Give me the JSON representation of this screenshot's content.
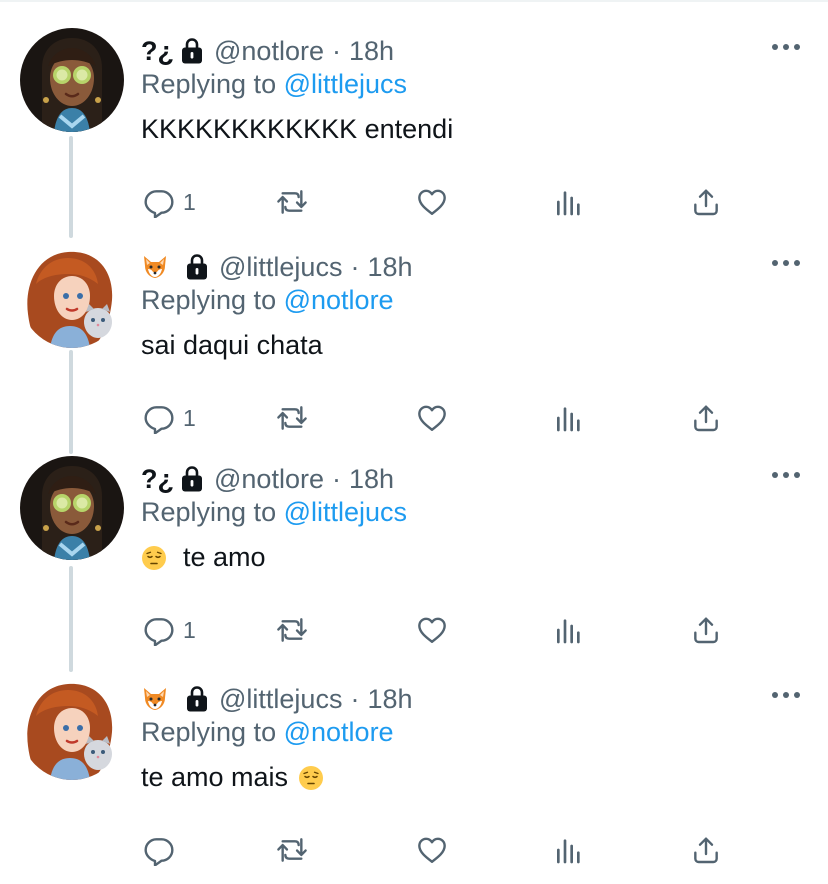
{
  "tweets": [
    {
      "name": "?¿",
      "handle": "@notlore",
      "dot": "·",
      "time": "18h",
      "replying_prefix": "Replying to",
      "replying_to": "@littlejucs",
      "text": "KKKKKKKKKKKK entendi",
      "reply_count": "1"
    },
    {
      "name": "",
      "handle": "@littlejucs",
      "dot": "·",
      "time": "18h",
      "replying_prefix": "Replying to",
      "replying_to": "@notlore",
      "text": "sai daqui chata",
      "reply_count": "1"
    },
    {
      "name": "?¿",
      "handle": "@notlore",
      "dot": "·",
      "time": "18h",
      "replying_prefix": "Replying to",
      "replying_to": "@littlejucs",
      "text": "te amo",
      "reply_count": "1"
    },
    {
      "name": "",
      "handle": "@littlejucs",
      "dot": "·",
      "time": "18h",
      "replying_prefix": "Replying to",
      "replying_to": "@notlore",
      "text": "te amo mais",
      "reply_count": ""
    }
  ],
  "icons": {
    "reply": "reply-icon",
    "retweet": "retweet-icon",
    "like": "heart-icon",
    "analytics": "analytics-icon",
    "share": "share-icon",
    "more": "more-icon",
    "lock": "lock-icon",
    "fox": "fox-emoji-icon",
    "pensive": "pensive-face-icon"
  },
  "colors": {
    "text": "#0f1419",
    "secondary": "#536471",
    "link": "#1d9bf0",
    "thread_line": "#cfd9de"
  }
}
